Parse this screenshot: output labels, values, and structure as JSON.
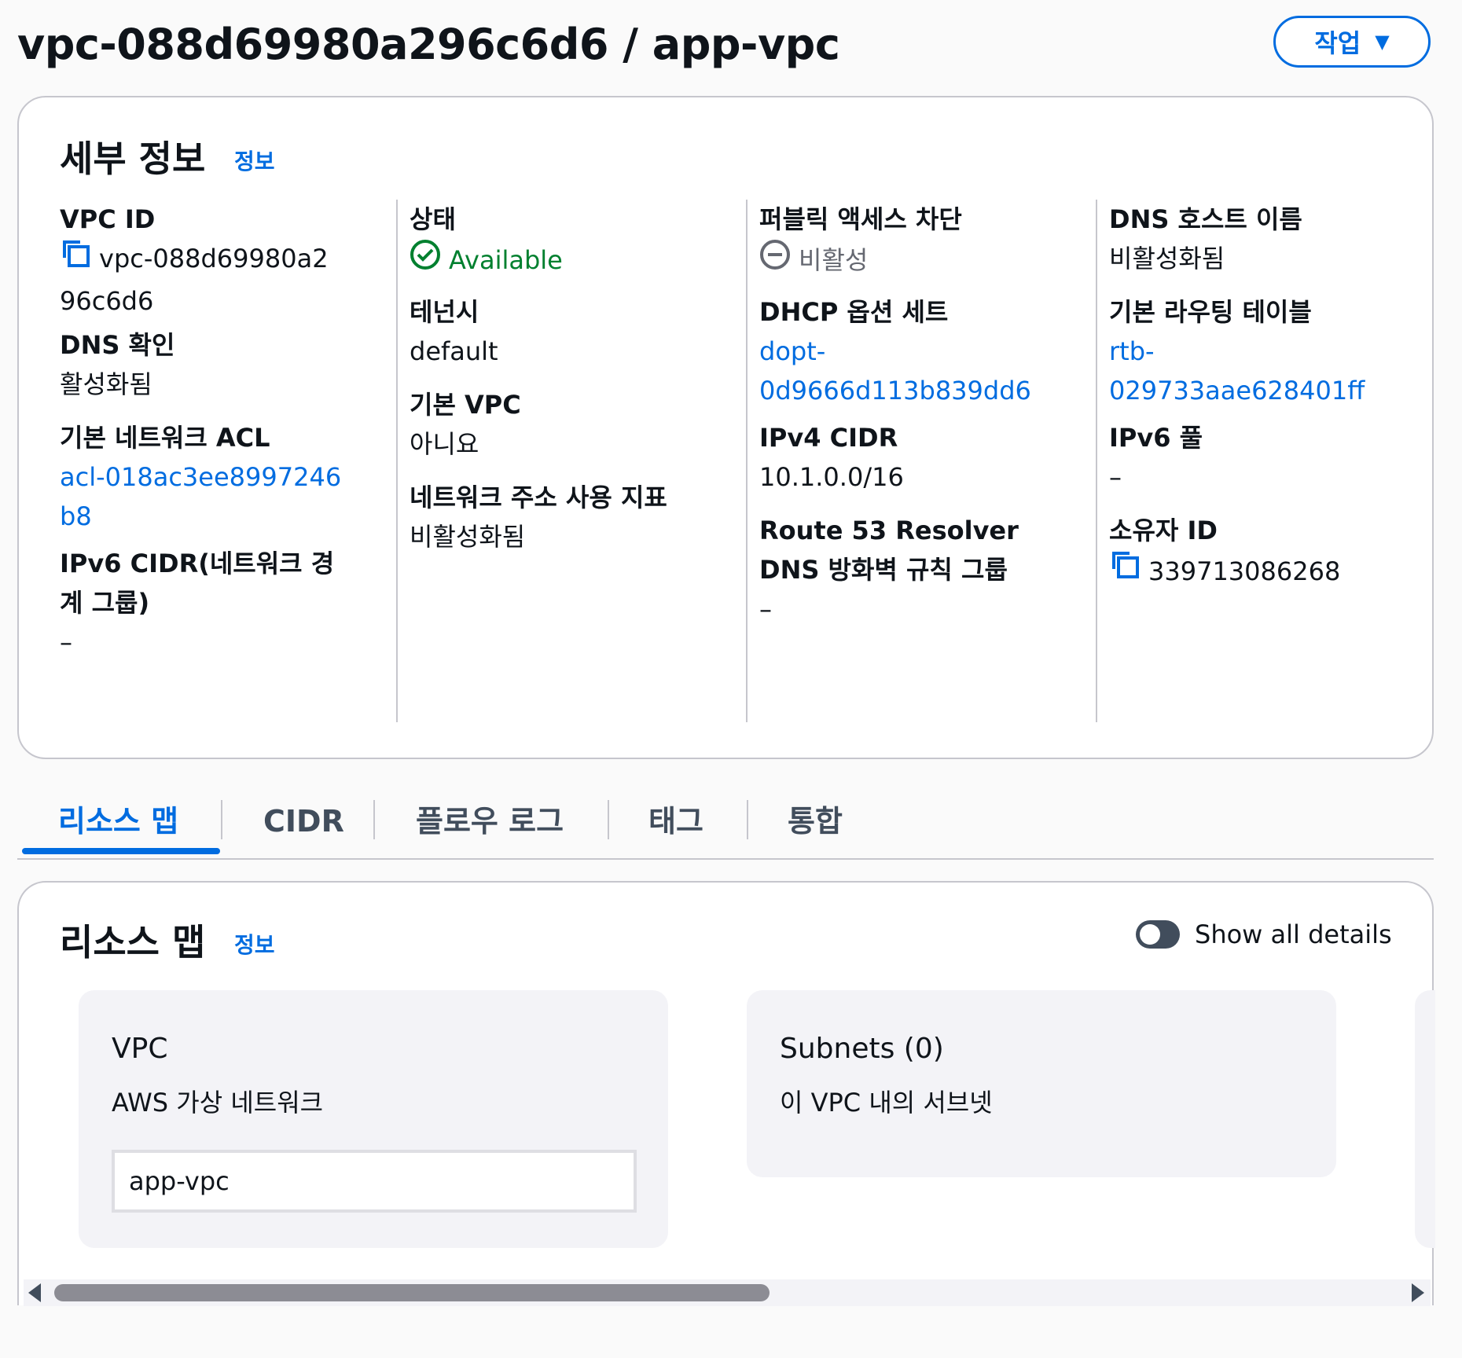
{
  "header": {
    "title": "vpc-088d69980a296c6d6 / app-vpc",
    "actions_label": "작업"
  },
  "details": {
    "title": "세부 정보",
    "info_link": "정보",
    "col1": {
      "vpc_id_label": "VPC ID",
      "vpc_id_value": "vpc-088d69980a296c6d6",
      "dns_resolution_label": "DNS 확인",
      "dns_resolution_value": "활성화됨",
      "default_acl_label": "기본 네트워크 ACL",
      "default_acl_value": "acl-018ac3ee8997246b8",
      "ipv6_cidr_label": "IPv6 CIDR(네트워크 경계 그룹)",
      "ipv6_cidr_value": "–"
    },
    "col2": {
      "state_label": "상태",
      "state_value": "Available",
      "tenancy_label": "테넌시",
      "tenancy_value": "default",
      "default_vpc_label": "기본 VPC",
      "default_vpc_value": "아니요",
      "net_addr_usage_label": "네트워크 주소 사용 지표",
      "net_addr_usage_value": "비활성화됨"
    },
    "col3": {
      "public_block_label": "퍼블릭 액세스 차단",
      "public_block_value": "비활성",
      "dhcp_label": "DHCP 옵션 세트",
      "dhcp_value_1": "dopt-",
      "dhcp_value_2": "0d9666d113b839dd6",
      "ipv4_cidr_label": "IPv4 CIDR",
      "ipv4_cidr_value": "10.1.0.0/16",
      "r53_label_1": "Route 53 Resolver",
      "r53_label_2": "DNS 방화벽 규칙 그룹",
      "r53_value": "–"
    },
    "col4": {
      "dns_hostnames_label": "DNS 호스트 이름",
      "dns_hostnames_value": "비활성화됨",
      "main_rt_label": "기본 라우팅 테이블",
      "main_rt_value_1": "rtb-",
      "main_rt_value_2": "029733aae628401ff",
      "ipv6_pool_label": "IPv6 풀",
      "ipv6_pool_value": "–",
      "owner_id_label": "소유자 ID",
      "owner_id_value": "339713086268"
    }
  },
  "tabs": [
    "리소스 맵",
    "CIDR",
    "플로우 로그",
    "태그",
    "통합"
  ],
  "resource_map": {
    "title": "리소스 맵",
    "info_link": "정보",
    "toggle_label": "Show all details",
    "vpc_node": {
      "title": "VPC",
      "subtitle": "AWS 가상 네트워크",
      "item": "app-vpc"
    },
    "subnets_node": {
      "title": "Subnets (0)",
      "subtitle": "이 VPC 내의 서브넷"
    }
  },
  "colors": {
    "link": "#006ce0",
    "available": "#00802f",
    "border": "#c6c6cd"
  }
}
